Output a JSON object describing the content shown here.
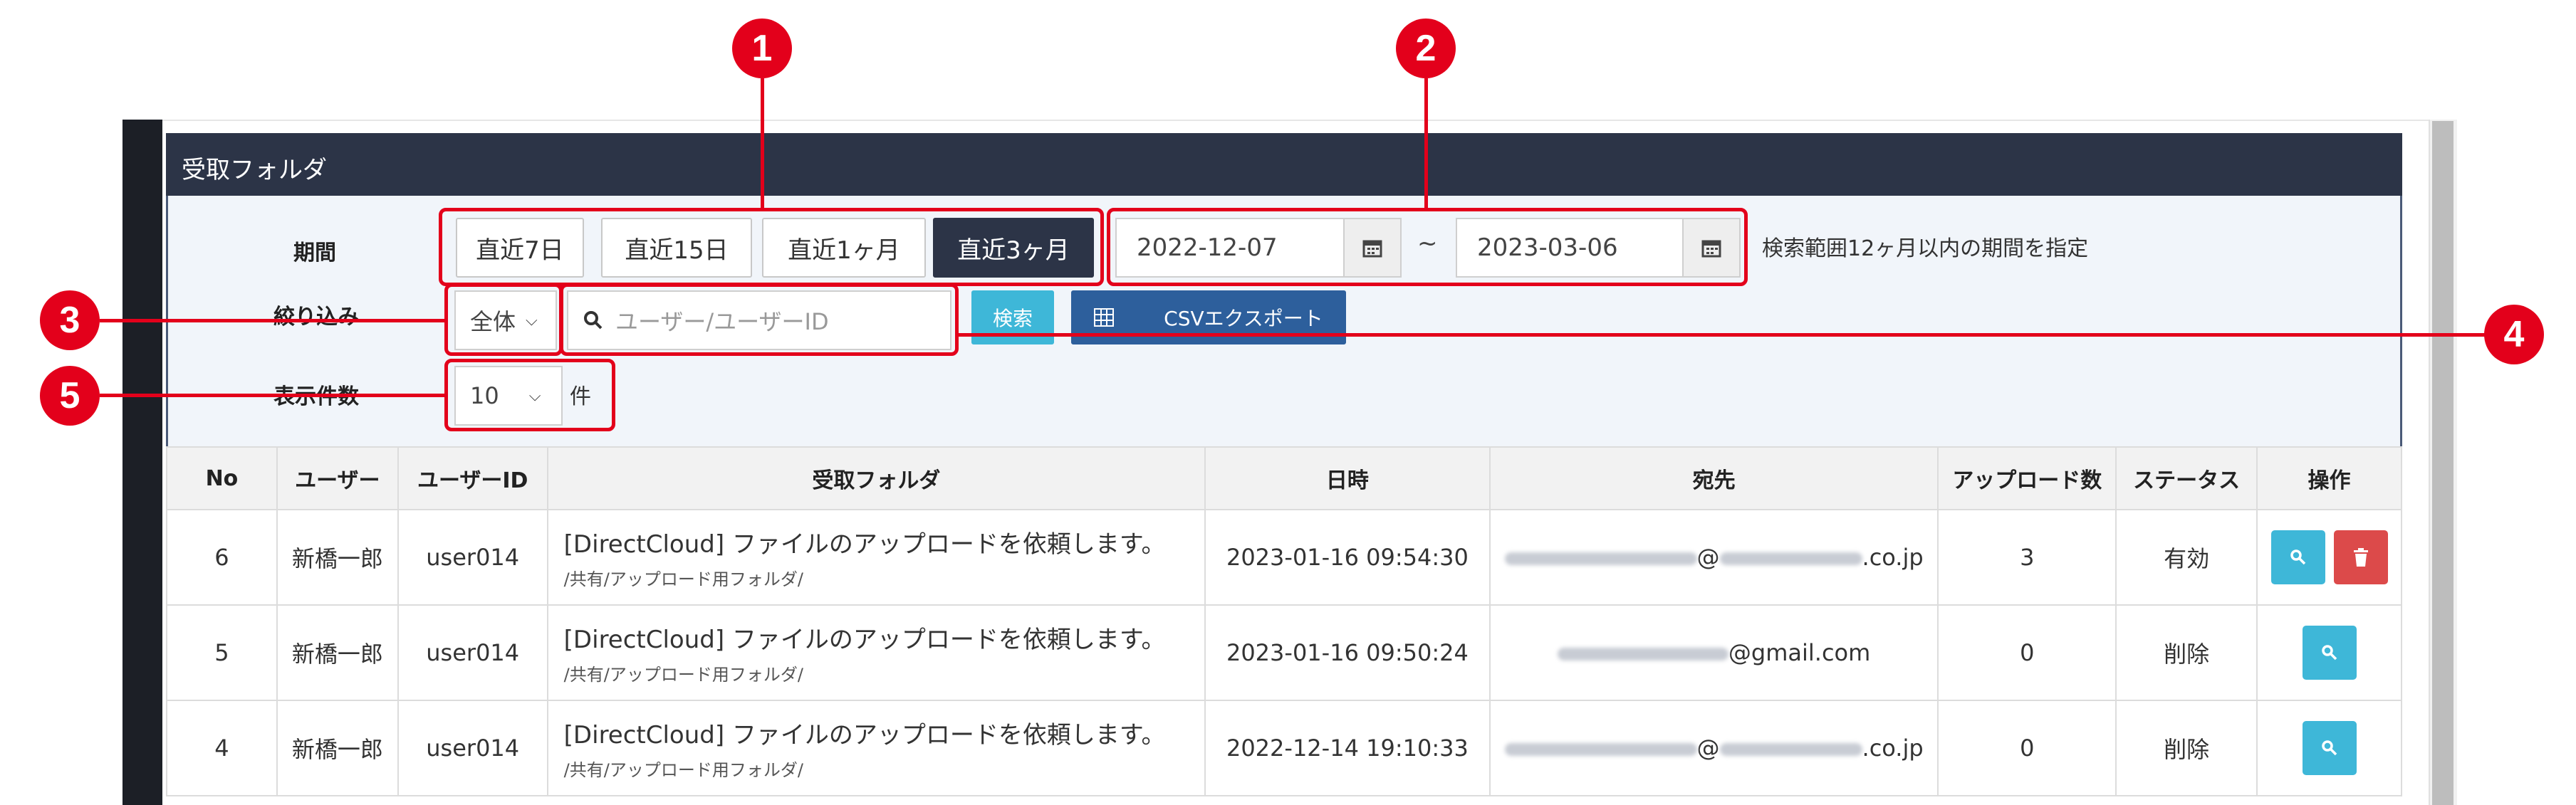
{
  "panel": {
    "title": "受取フォルダ"
  },
  "filter": {
    "period_label": "期間",
    "period_buttons": [
      "直近7日",
      "直近15日",
      "直近1ヶ月",
      "直近3ヶ月"
    ],
    "active_period": "直近3ヶ月",
    "date_from": "2022-12-07",
    "date_to": "2023-03-06",
    "tilde": "~",
    "range_note": "検索範囲12ヶ月以内の期間を指定",
    "narrow_label": "絞り込み",
    "narrow_select": "全体",
    "search_placeholder": "ユーザー/ユーザーID",
    "search_button": "検索",
    "csv_button": "CSVエクスポート",
    "count_label": "表示件数",
    "count_select": "10",
    "count_unit": "件"
  },
  "callouts": [
    "1",
    "2",
    "3",
    "4",
    "5"
  ],
  "table": {
    "headers": [
      "No",
      "ユーザー",
      "ユーザーID",
      "受取フォルダ",
      "日時",
      "宛先",
      "アップロード数",
      "ステータス",
      "操作"
    ],
    "rows": [
      {
        "no": "6",
        "user": "新橋一郎",
        "user_id": "user014",
        "folder_title": "[DirectCloud] ファイルのアップロードを依頼します。",
        "folder_path": "/共有/アップロード用フォルダ/",
        "datetime": "2023-01-16 09:54:30",
        "dest_at": "@",
        "dest_suffix": ".co.jp",
        "uploads": "3",
        "status": "有効"
      },
      {
        "no": "5",
        "user": "新橋一郎",
        "user_id": "user014",
        "folder_title": "[DirectCloud] ファイルのアップロードを依頼します。",
        "folder_path": "/共有/アップロード用フォルダ/",
        "datetime": "2023-01-16 09:50:24",
        "dest_at": "",
        "dest_suffix": "@gmail.com",
        "uploads": "0",
        "status": "削除"
      },
      {
        "no": "4",
        "user": "新橋一郎",
        "user_id": "user014",
        "folder_title": "[DirectCloud] ファイルのアップロードを依頼します。",
        "folder_path": "/共有/アップロード用フォルダ/",
        "datetime": "2022-12-14 19:10:33",
        "dest_at": "@",
        "dest_suffix": ".co.jp",
        "uploads": "0",
        "status": "削除"
      }
    ]
  },
  "colors": {
    "accent_red": "#e3001b",
    "header_dark": "#2c3447",
    "info": "#3eb7d8",
    "danger": "#dc4a4a"
  }
}
